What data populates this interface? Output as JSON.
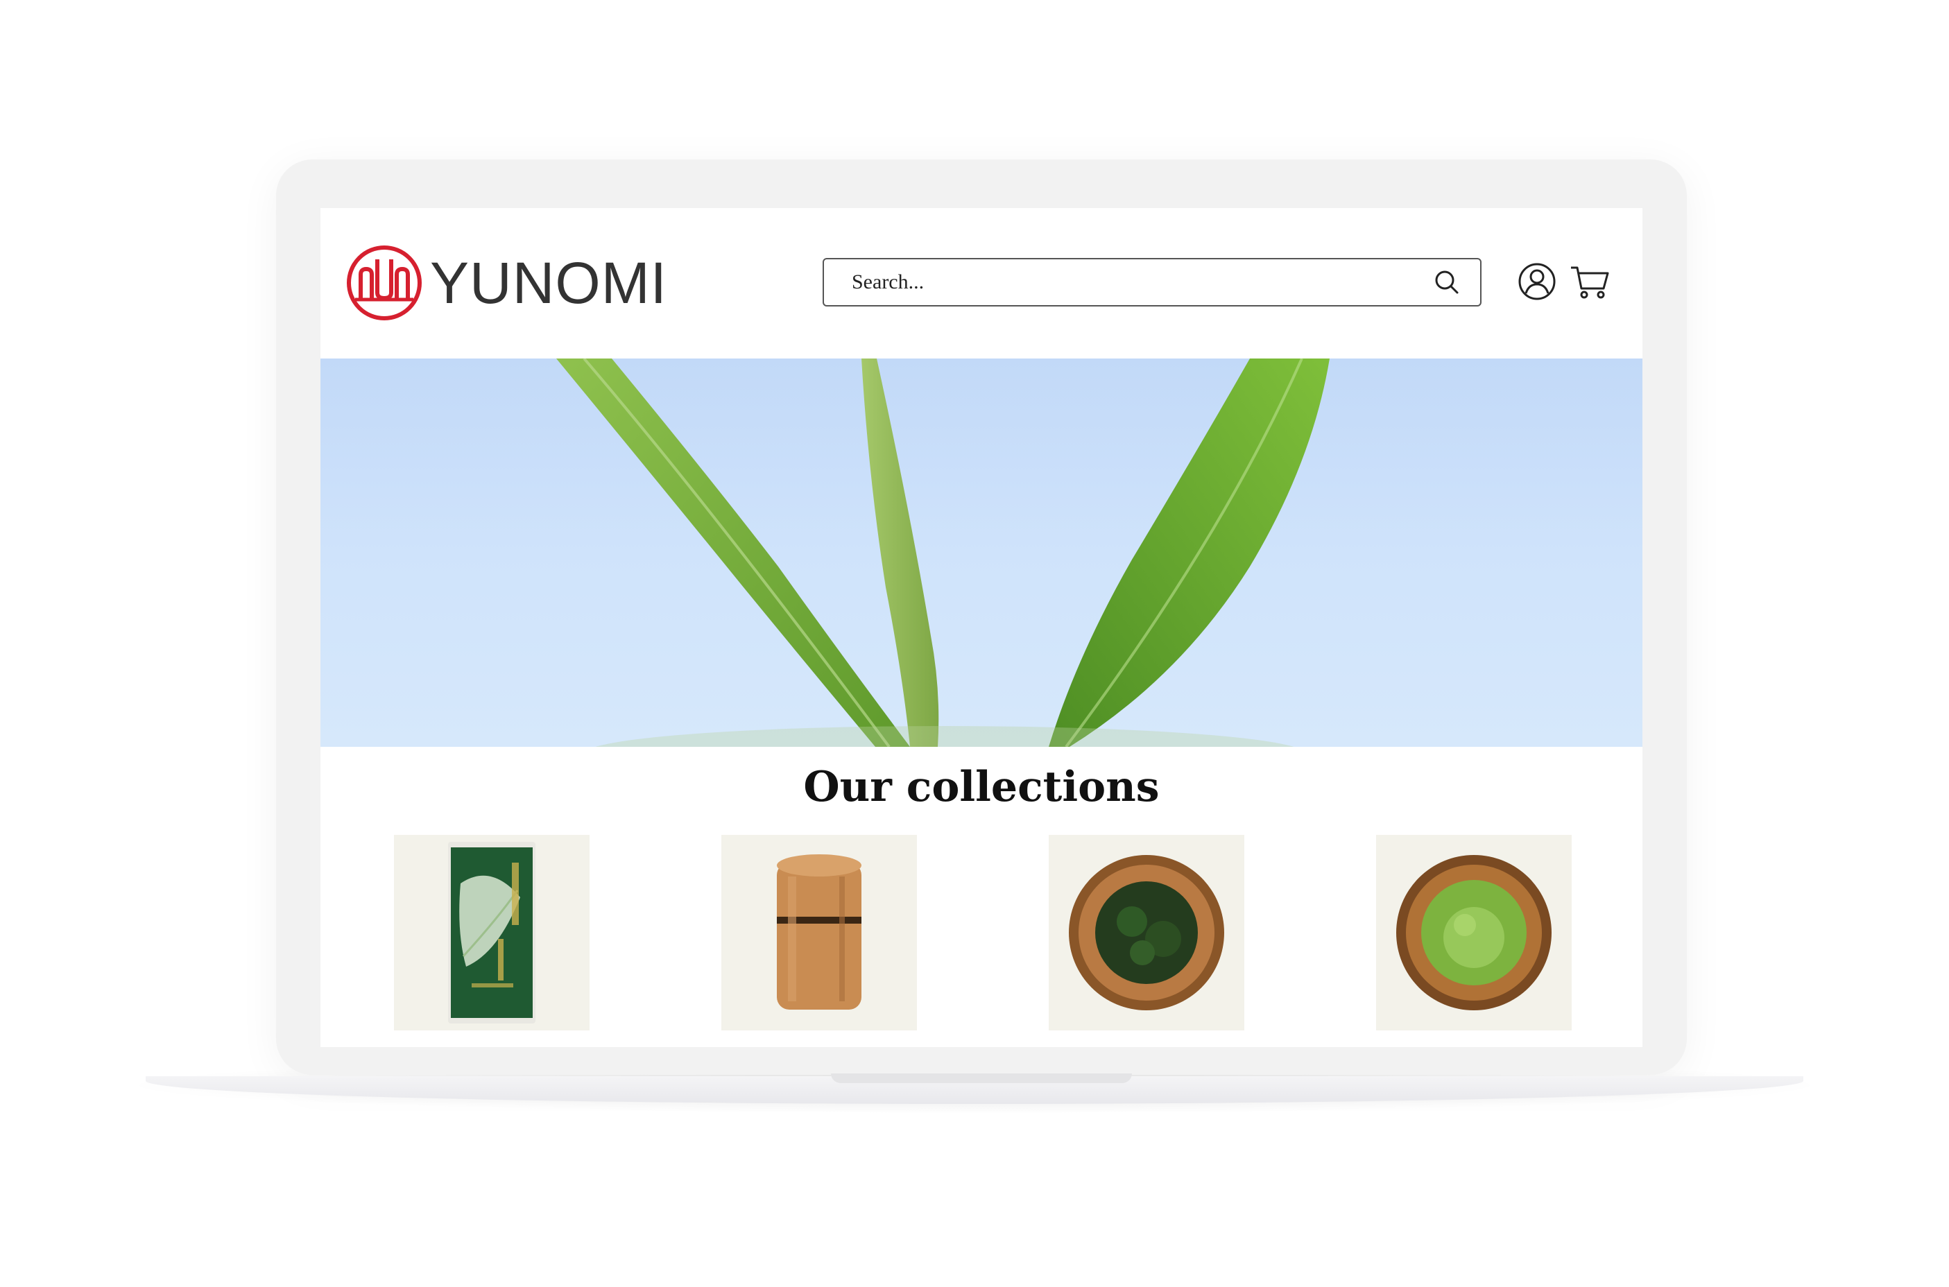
{
  "brand": {
    "name": "YUNOMI",
    "accent": "#d6202f"
  },
  "header": {
    "search": {
      "placeholder": "Search...",
      "icon": "search-icon"
    },
    "account_icon": "user-circle-icon",
    "cart_icon": "shopping-cart-icon"
  },
  "hero": {
    "subject": "green tea leaves against blue sky",
    "sky_color": "#c9defa",
    "leaf_color": "#7cb043"
  },
  "collections": {
    "title": "Our collections",
    "items": [
      {
        "image": "green tea bag"
      },
      {
        "image": "wooden tea canister"
      },
      {
        "image": "sencha leaves on wooden plate"
      },
      {
        "image": "matcha powder in wooden bowl"
      }
    ]
  }
}
